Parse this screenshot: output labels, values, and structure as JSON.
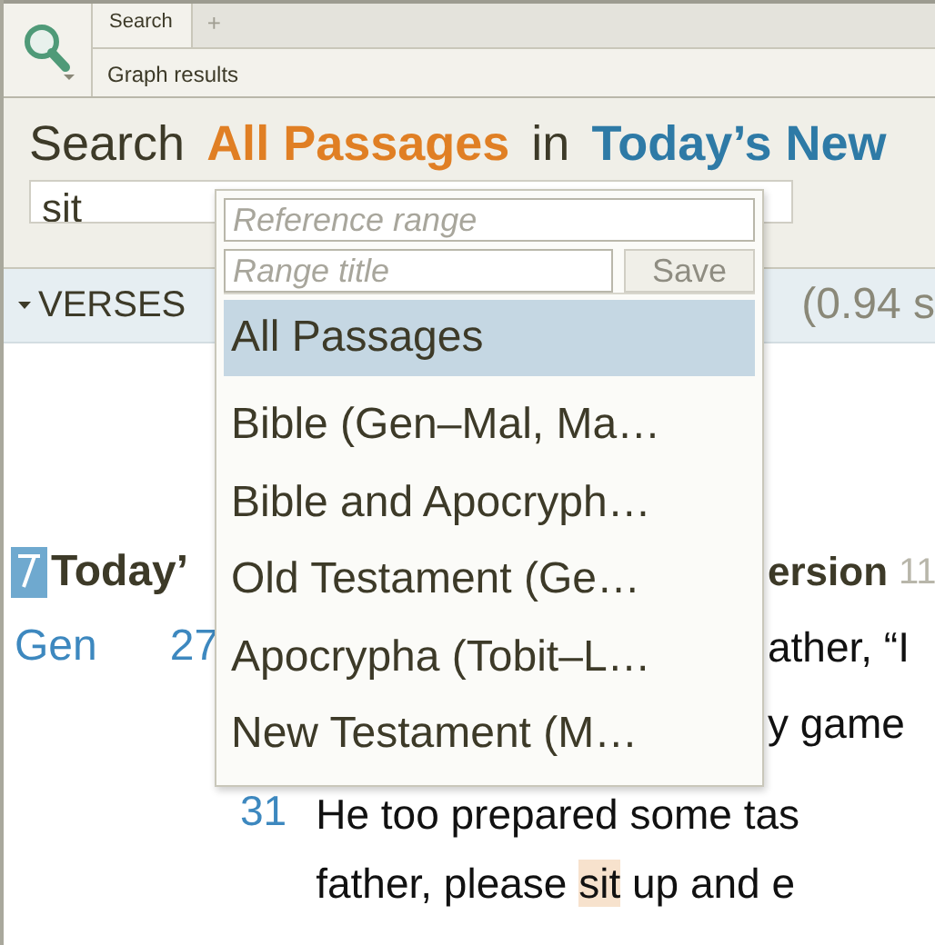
{
  "toolbar": {
    "tabs": [
      {
        "label": "Search",
        "selected": true
      }
    ],
    "add_tab": "+",
    "subtitle": "Graph results"
  },
  "header": {
    "prefix": "Search",
    "range": "All Passages",
    "joiner": "in",
    "version": "Today’s New",
    "query": "sit"
  },
  "results_bar": {
    "expanded": true,
    "label": "VERSES",
    "timing": "(0.94 s"
  },
  "dropdown": {
    "reference_placeholder": "Reference range",
    "title_placeholder": "Range title",
    "save_label": "Save",
    "save_disabled": true,
    "items": [
      {
        "label": "All Passages",
        "selected": true
      },
      {
        "label": "Bible (Gen–Mal, Ma…",
        "selected": false
      },
      {
        "label": "Bible and Apocryph…",
        "selected": false
      },
      {
        "label": "Old Testament (Ge…",
        "selected": false
      },
      {
        "label": "Apocrypha (Tobit–L…",
        "selected": false
      },
      {
        "label": "New Testament (M…",
        "selected": false
      }
    ]
  },
  "results": {
    "title_left": "Today’",
    "title_right": "ersion",
    "title_count": "11",
    "rows": [
      {
        "book": "Gen",
        "chapter": "27",
        "text_right": "ather, “I"
      },
      {
        "book": "",
        "chapter": "",
        "text_right": "y game"
      }
    ],
    "verse": {
      "number": "31",
      "lines": [
        [
          {
            "text": "He too prepared some tas",
            "hit": false
          }
        ],
        [
          {
            "text": "father, please ",
            "hit": false
          },
          {
            "text": "sit",
            "hit": true
          },
          {
            "text": " up and e",
            "hit": false
          }
        ]
      ]
    }
  }
}
